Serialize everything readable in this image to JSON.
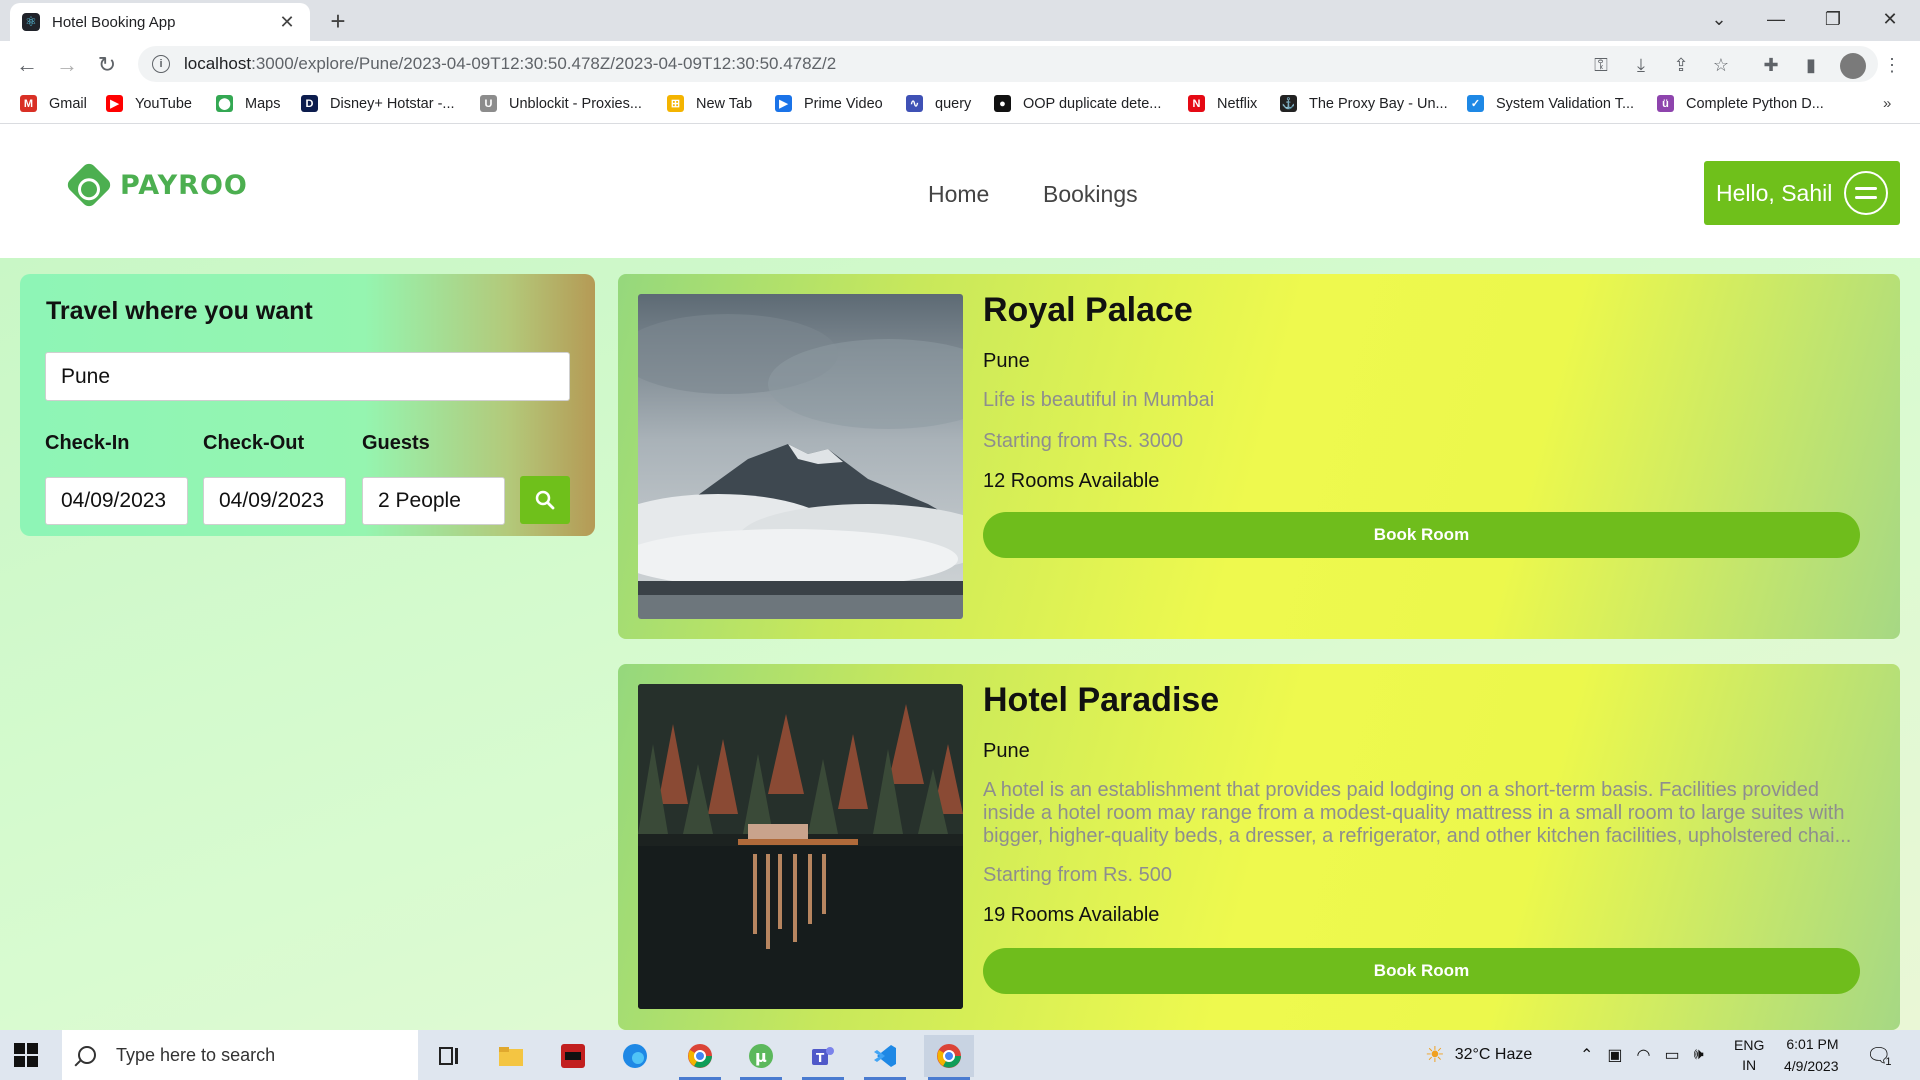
{
  "browser": {
    "tab_title": "Hotel Booking App",
    "url_host": "localhost",
    "url_path": ":3000/explore/Pune/2023-04-09T12:30:50.478Z/2023-04-09T12:30:50.478Z/2",
    "bookmarks": [
      {
        "label": "Gmail",
        "color": "#d93025",
        "glyph": "M"
      },
      {
        "label": "YouTube",
        "color": "#ff0000",
        "glyph": "▶"
      },
      {
        "label": "Maps",
        "color": "#34a853",
        "glyph": "⬤"
      },
      {
        "label": "Disney+ Hotstar -...",
        "color": "#0c1c4d",
        "glyph": "D"
      },
      {
        "label": "Unblockit - Proxies...",
        "color": "#8c8c8c",
        "glyph": "U"
      },
      {
        "label": "New Tab",
        "color": "#f4b400",
        "glyph": "⊞"
      },
      {
        "label": "Prime Video",
        "color": "#1a73e8",
        "glyph": "▶"
      },
      {
        "label": "query",
        "color": "#3f51b5",
        "glyph": "∿"
      },
      {
        "label": "OOP duplicate dete...",
        "color": "#111111",
        "glyph": "●"
      },
      {
        "label": "Netflix",
        "color": "#e50914",
        "glyph": "N"
      },
      {
        "label": "The Proxy Bay - Un...",
        "color": "#222222",
        "glyph": "⚓"
      },
      {
        "label": "System Validation T...",
        "color": "#1e88e5",
        "glyph": "✓"
      },
      {
        "label": "Complete Python D...",
        "color": "#8e44ad",
        "glyph": "ü"
      }
    ],
    "more_bookmarks": "»"
  },
  "app": {
    "brand": "PAYROO",
    "nav": {
      "home": "Home",
      "bookings": "Bookings"
    },
    "greeting": "Hello, Sahil",
    "search": {
      "heading": "Travel where you want",
      "location": "Pune",
      "checkin_label": "Check-In",
      "checkout_label": "Check-Out",
      "guests_label": "Guests",
      "checkin": "04/09/2023",
      "checkout": "04/09/2023",
      "guests": "2 People"
    },
    "hotels": [
      {
        "name": "Royal Palace",
        "city": "Pune",
        "description": "Life is beautiful in Mumbai",
        "price": "Starting from Rs. 3000",
        "rooms": "12 Rooms Available",
        "button": "Book Room"
      },
      {
        "name": "Hotel Paradise",
        "city": "Pune",
        "description": "A hotel is an establishment that provides paid lodging on a short-term basis. Facilities provided inside a hotel room may range from a modest-quality mattress in a small room to large suites with bigger, higher-quality beds, a dresser, a refrigerator, and other kitchen facilities, upholstered chai...",
        "price": "Starting from Rs. 500",
        "rooms": "19 Rooms Available",
        "button": "Book Room"
      }
    ]
  },
  "taskbar": {
    "search_placeholder": "Type here to search",
    "weather": "32°C  Haze",
    "lang_top": "ENG",
    "lang_bottom": "IN",
    "time": "6:01 PM",
    "date": "4/9/2023",
    "notif_count": "1"
  },
  "colors": {
    "accent": "#6fc01b",
    "brand": "#4caf50"
  }
}
